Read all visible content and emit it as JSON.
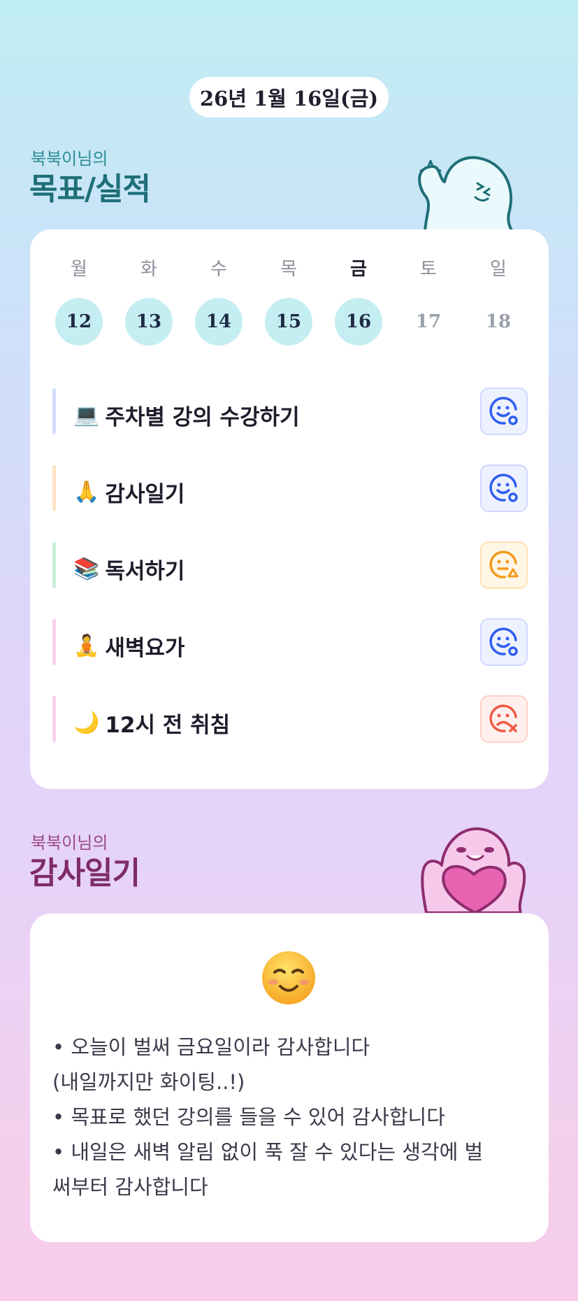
{
  "date": "26년 1월 16일(금)",
  "goals_section": {
    "owner": "북북이님의",
    "title": "목표/실적"
  },
  "week": [
    {
      "label": "월",
      "num": "12",
      "done": true,
      "today": false
    },
    {
      "label": "화",
      "num": "13",
      "done": true,
      "today": false
    },
    {
      "label": "수",
      "num": "14",
      "done": true,
      "today": false
    },
    {
      "label": "목",
      "num": "15",
      "done": true,
      "today": false
    },
    {
      "label": "금",
      "num": "16",
      "done": true,
      "today": true
    },
    {
      "label": "토",
      "num": "17",
      "done": false,
      "today": false
    },
    {
      "label": "일",
      "num": "18",
      "done": false,
      "today": false
    }
  ],
  "goals": [
    {
      "emoji": "💻",
      "label": "주차별 강의 수강하기",
      "status": "success",
      "accent": "#d3defb"
    },
    {
      "emoji": "🙏",
      "label": "감사일기",
      "status": "success",
      "accent": "#ffe2c4"
    },
    {
      "emoji": "📚",
      "label": "독서하기",
      "status": "partial",
      "accent": "#c8efd8"
    },
    {
      "emoji": "🧘",
      "label": "새벽요가",
      "status": "success",
      "accent": "#f9d2ea"
    },
    {
      "emoji": "🌙",
      "label": "12시 전 취침",
      "status": "fail",
      "accent": "#f9d2ea"
    }
  ],
  "status_colors": {
    "success": "#2f5ef0",
    "partial": "#f29a1d",
    "fail": "#ef5a45"
  },
  "diary_section": {
    "owner": "북북이님의",
    "title": "감사일기"
  },
  "diary": {
    "mood_emoji": "smiling-face-icon",
    "lines": [
      "•  오늘이 벌써 금요일이라 감사합니다",
      "(내일까지만 화이팅..!)",
      "•  목표로 했던 강의를 들을 수 있어 감사합니다",
      "•  내일은 새벽 알림 없이 푹 잘 수 있다는 생각에 벌",
      "써부터 감사합니다"
    ]
  }
}
